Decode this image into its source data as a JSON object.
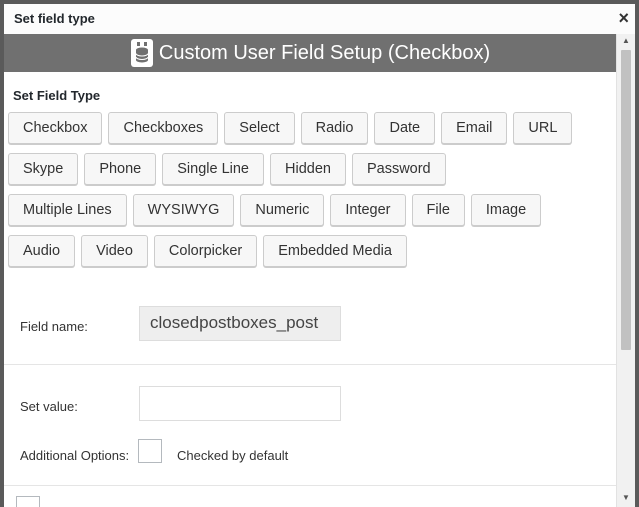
{
  "dialog": {
    "title": "Set field type",
    "close_symbol": "×"
  },
  "banner": {
    "icon": "database-icon",
    "text": "Custom User Field Setup  (Checkbox)"
  },
  "field_types": {
    "label": "Set Field Type",
    "rows": [
      [
        "Checkbox",
        "Checkboxes",
        "Select",
        "Radio",
        "Date",
        "Email",
        "URL"
      ],
      [
        "Skype",
        "Phone",
        "Single Line",
        "Hidden",
        "Password"
      ],
      [
        "Multiple Lines",
        "WYSIWYG",
        "Numeric",
        "Integer",
        "File",
        "Image"
      ],
      [
        "Audio",
        "Video",
        "Colorpicker",
        "Embedded Media"
      ]
    ]
  },
  "form": {
    "field_name_label": "Field name:",
    "field_name_value": "closedpostboxes_post",
    "set_value_label": "Set value:",
    "set_value_value": "",
    "additional_options_label": "Additional Options:",
    "checked_by_default_label": "Checked by default"
  },
  "colors": {
    "banner_bg": "#707070",
    "button_bg": "#f7f7f7",
    "frame": "#5a5a5a"
  }
}
